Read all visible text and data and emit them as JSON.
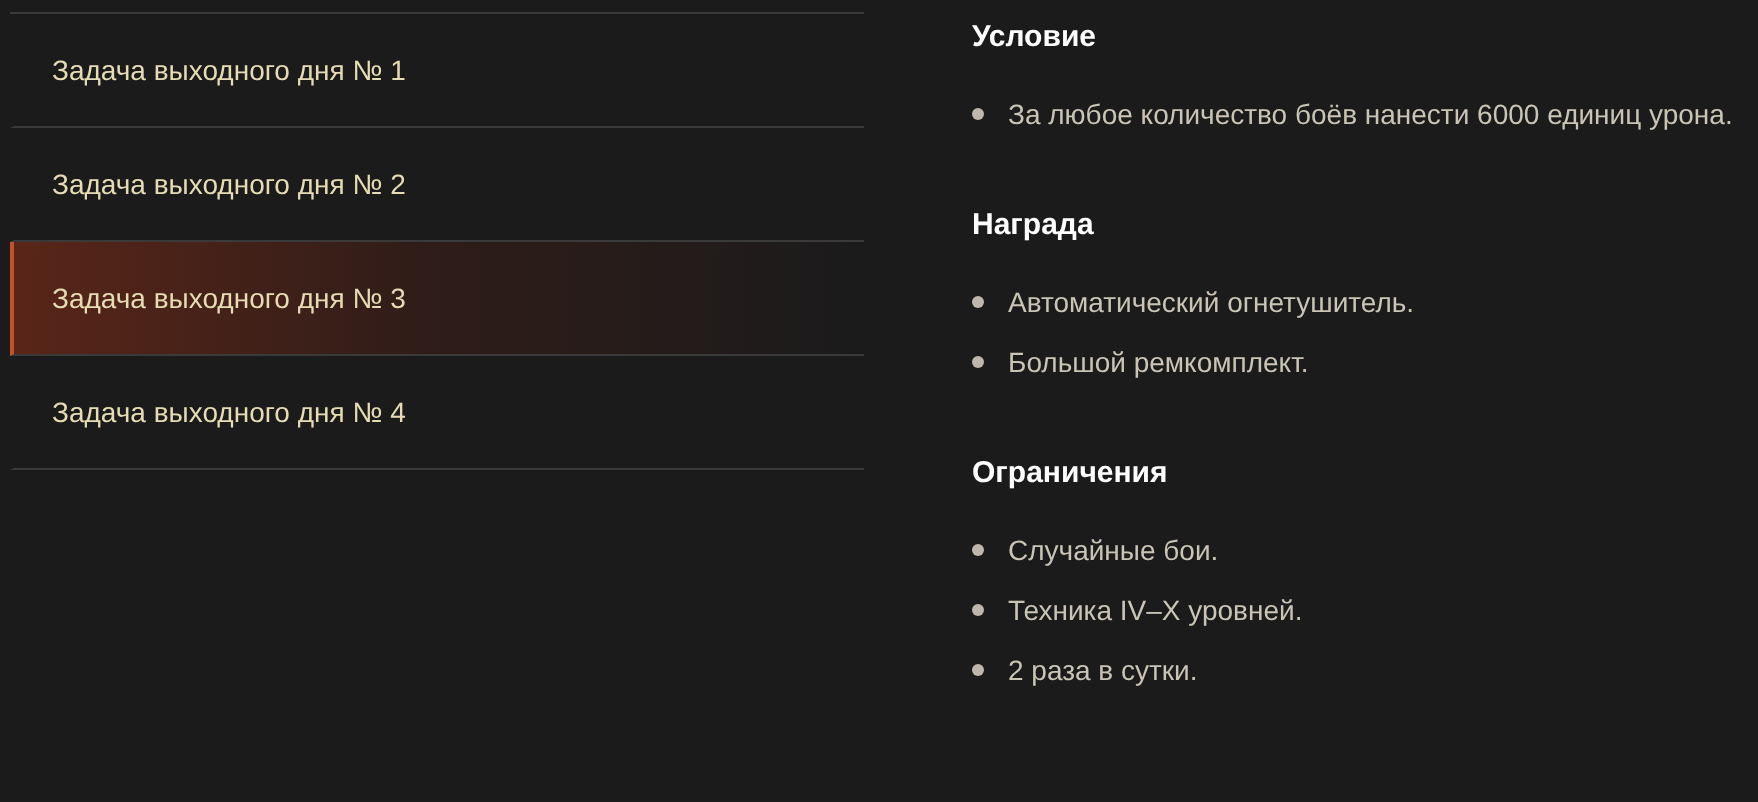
{
  "tasks": [
    {
      "label": "Задача выходного дня № 1",
      "selected": false
    },
    {
      "label": "Задача выходного дня № 2",
      "selected": false
    },
    {
      "label": "Задача выходного дня № 3",
      "selected": true
    },
    {
      "label": "Задача выходного дня № 4",
      "selected": false
    }
  ],
  "sections": [
    {
      "title": "Условие",
      "items": [
        "За любое количество боёв нанести 6000 единиц урона."
      ]
    },
    {
      "title": "Награда",
      "items": [
        "Автоматический огнетушитель.",
        "Большой ремкомплект."
      ]
    },
    {
      "title": "Ограничения",
      "items": [
        "Случайные бои.",
        "Техника IV–X уровней.",
        "2 раза в сутки."
      ]
    }
  ]
}
